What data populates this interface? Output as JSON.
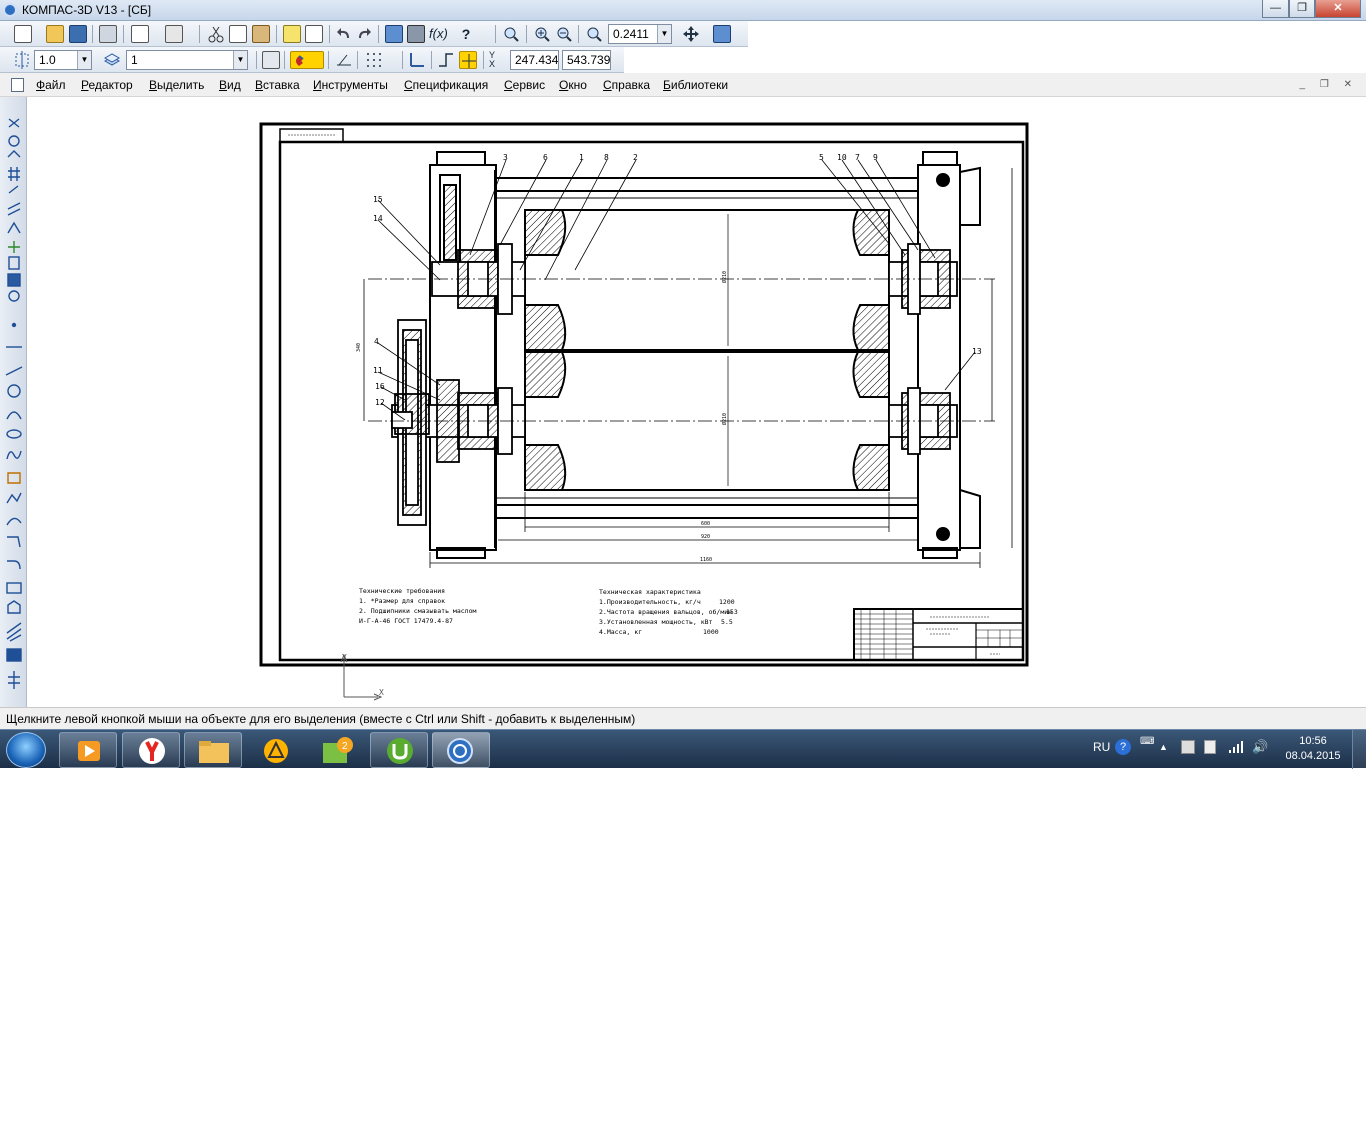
{
  "window": {
    "title": "КОМПАС-3D V13 - [СБ]",
    "buttons": [
      "minimize",
      "maximize",
      "close"
    ]
  },
  "toolbar_main": {
    "zoom_value": "0.2411"
  },
  "toolbar_current": {
    "step_value": "1.0",
    "layer_value": "1",
    "x_coord": "247.434",
    "y_coord": "543.739"
  },
  "menu": {
    "items": [
      "Файл",
      "Редактор",
      "Выделить",
      "Вид",
      "Вставка",
      "Инструменты",
      "Спецификация",
      "Сервис",
      "Окно",
      "Справка",
      "Библиотеки"
    ]
  },
  "drawing": {
    "position_labels": [
      "3",
      "6",
      "1",
      "8",
      "2",
      "5",
      "10",
      "7",
      "9",
      "15",
      "14",
      "4",
      "11",
      "16",
      "12",
      "13"
    ],
    "dimensions": [
      "600",
      "920",
      "1160",
      "340",
      "Ø210",
      "Ø210"
    ],
    "tech_requirements": {
      "title": "Технические требования",
      "lines": [
        "1. *Размер для справок",
        "2. Подшипники смазывать маслом",
        "И-Г-А-46 ГОСТ 17479.4-87"
      ]
    },
    "tech_characteristics": {
      "title": "Техническая характеристика",
      "rows": [
        {
          "label": "1.Производительность, кг/ч",
          "value": "1200"
        },
        {
          "label": "2.Частота вращения вальцов, об/мин",
          "value": "153"
        },
        {
          "label": "3.Установленная мощность, кВт",
          "value": "5.5"
        },
        {
          "label": "4.Масса, кг",
          "value": "1000"
        }
      ]
    },
    "axis_labels": {
      "x": "X",
      "y": "Y"
    }
  },
  "status": {
    "message": "Щелкните левой кнопкой мыши на объекте для его выделения (вместе с Ctrl или Shift - добавить к выделенным)"
  },
  "taskbar": {
    "apps": [
      "media-player",
      "yandex-browser",
      "file-explorer",
      "aimp",
      "icq",
      "utorrent",
      "kompas-3d"
    ],
    "language": "RU",
    "time": "10:56",
    "date": "08.04.2015"
  },
  "colors": {
    "title_bar": "#c6d6ea",
    "taskbar": "#1c2f47",
    "hatch": "#000000",
    "highlight": "#ffd200"
  }
}
